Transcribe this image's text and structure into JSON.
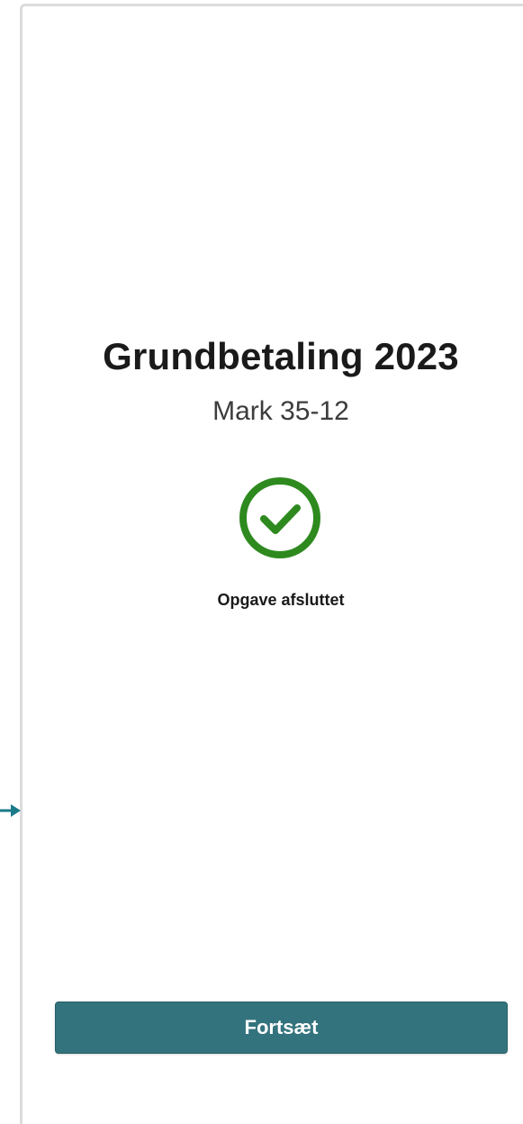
{
  "main": {
    "title": "Grundbetaling 2023",
    "subtitle": "Mark 35-12",
    "status_icon": "check-circle-icon",
    "status_text": "Opgave afsluttet"
  },
  "footer": {
    "continue_label": "Fortsæt"
  },
  "colors": {
    "accent": "#33737d",
    "success": "#2e8a1f",
    "arrow": "#1b7a8a"
  }
}
